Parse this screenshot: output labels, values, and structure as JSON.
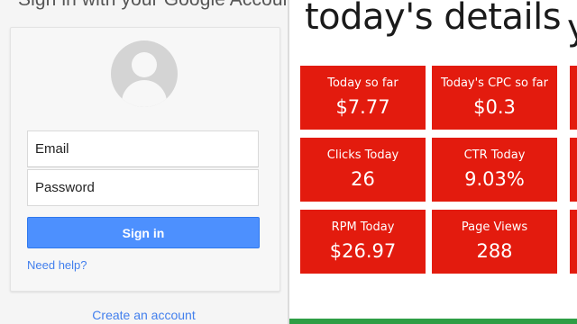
{
  "signin": {
    "title": "Sign in with your Google Account",
    "email_placeholder": "Email",
    "password_placeholder": "Password",
    "signin_button": "Sign in",
    "help_link": "Need help?",
    "create_account": "Create an account"
  },
  "details": {
    "title": "today's details",
    "next_panel_peek": "y",
    "tiles": [
      {
        "label": "Today so far",
        "value": "$7.77"
      },
      {
        "label": "Today's CPC so far",
        "value": "$0.3"
      },
      {
        "label": "Clicks Today",
        "value": "26"
      },
      {
        "label": "CTR Today",
        "value": "9.03%"
      },
      {
        "label": "RPM Today",
        "value": "$26.97"
      },
      {
        "label": "Page Views",
        "value": "288"
      }
    ]
  },
  "colors": {
    "tile_red": "#e31b0e",
    "signin_blue": "#4d90fe",
    "link_blue": "#427fed"
  },
  "icons": [
    "default-avatar-icon"
  ]
}
